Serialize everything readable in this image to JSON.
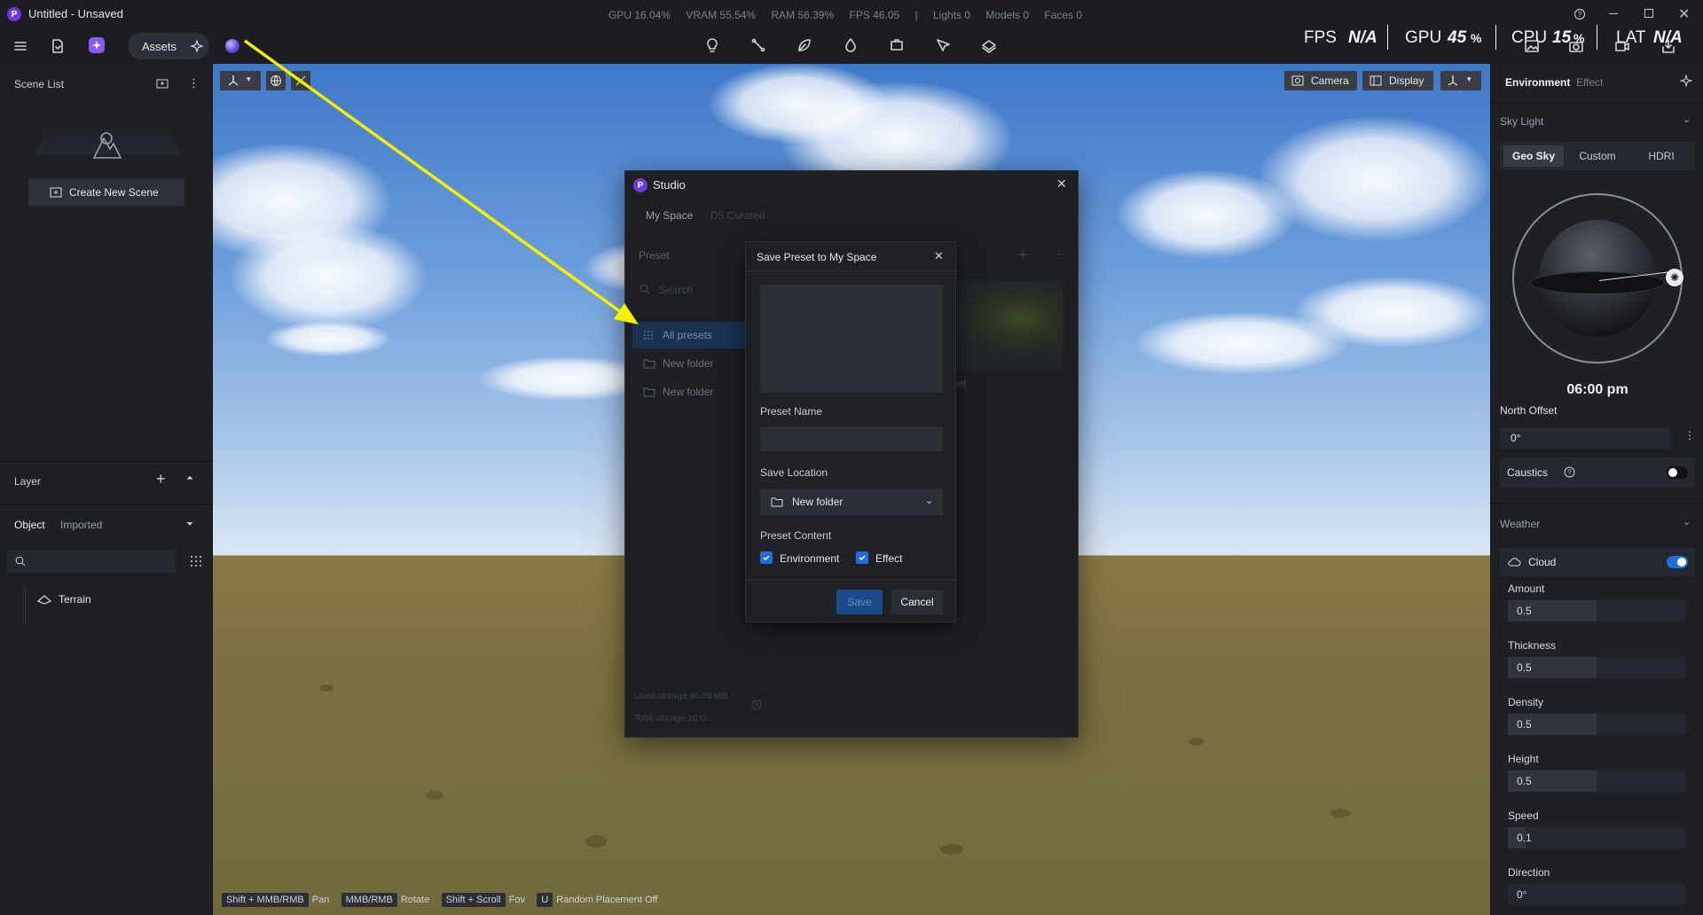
{
  "titlebar": {
    "app_title": "Untitled - Unsaved",
    "stats": {
      "gpu": "GPU 16.04%",
      "vram": "VRAM 55.54%",
      "ram": "RAM 56.39%",
      "fps": "FPS 46.05",
      "sep": "|",
      "lights": "Lights 0",
      "models": "Models 0",
      "faces": "Faces 0"
    }
  },
  "toolbar": {
    "assets_label": "Assets",
    "perf": {
      "fps_label": "FPS",
      "fps_value": "N/A",
      "gpu_label": "GPU",
      "gpu_value": "45",
      "gpu_unit": "%",
      "cpu_label": "CPU",
      "cpu_value": "15",
      "cpu_unit": "%",
      "lat_label": "LAT",
      "lat_value": "N/A"
    }
  },
  "scene_list": {
    "title": "Scene List",
    "create_label": "Create New Scene"
  },
  "layer": {
    "title": "Layer",
    "tabs": [
      "Object",
      "Imported"
    ],
    "items": [
      {
        "label": "Terrain"
      }
    ]
  },
  "viewport": {
    "camera_label": "Camera",
    "display_label": "Display",
    "hints": [
      {
        "key": "Shift + MMB/RMB",
        "label": "Pan"
      },
      {
        "key": "MMB/RMB",
        "label": "Rotate"
      },
      {
        "key": "Shift + Scroll",
        "label": "Fov"
      },
      {
        "key": "U",
        "label": "Random Placement Off"
      }
    ]
  },
  "studio": {
    "title": "Studio",
    "tabs": [
      "My Space",
      "D5 Curated"
    ],
    "section_label": "Preset",
    "search_placeholder": "Search",
    "folders": [
      {
        "label": "All presets"
      },
      {
        "label": "New folder"
      },
      {
        "label": "New folder"
      }
    ],
    "preset_suffix": "et",
    "used_storage": "Used storage 96.09 MB",
    "total_storage": "Total storage 10 G"
  },
  "save_dialog": {
    "title": "Save Preset to My Space",
    "name_label": "Preset Name",
    "name_value": "",
    "location_label": "Save Location",
    "location_value": "New folder",
    "content_label": "Preset Content",
    "checks": [
      {
        "label": "Environment",
        "checked": true
      },
      {
        "label": "Effect",
        "checked": true
      }
    ],
    "save_label": "Save",
    "cancel_label": "Cancel"
  },
  "right_panel": {
    "tabs": [
      "Environment",
      "Effect"
    ],
    "sky_light_title": "Sky Light",
    "sky_tabs": [
      "Geo Sky",
      "Custom",
      "HDRI"
    ],
    "time": "06:00 pm",
    "north_offset_label": "North Offset",
    "north_offset_value": "0°",
    "caustics_label": "Caustics",
    "caustics_on": false,
    "weather_title": "Weather",
    "cloud_label": "Cloud",
    "cloud_on": true,
    "sliders": [
      {
        "label": "Amount",
        "value": "0.5",
        "fraction": 0.5
      },
      {
        "label": "Thickness",
        "value": "0.5",
        "fraction": 0.5
      },
      {
        "label": "Density",
        "value": "0.5",
        "fraction": 0.5
      },
      {
        "label": "Height",
        "value": "0.5",
        "fraction": 0.5
      },
      {
        "label": "Speed",
        "value": "0.1",
        "fraction": 0.1
      },
      {
        "label": "Direction",
        "value": "0°",
        "fraction": 0.0
      }
    ]
  },
  "colors": {
    "accent": "#1f6fd6",
    "annotation_arrow": "#f5f000",
    "app_bg": "#1b1d22",
    "panel_bg": "#1e2026"
  }
}
